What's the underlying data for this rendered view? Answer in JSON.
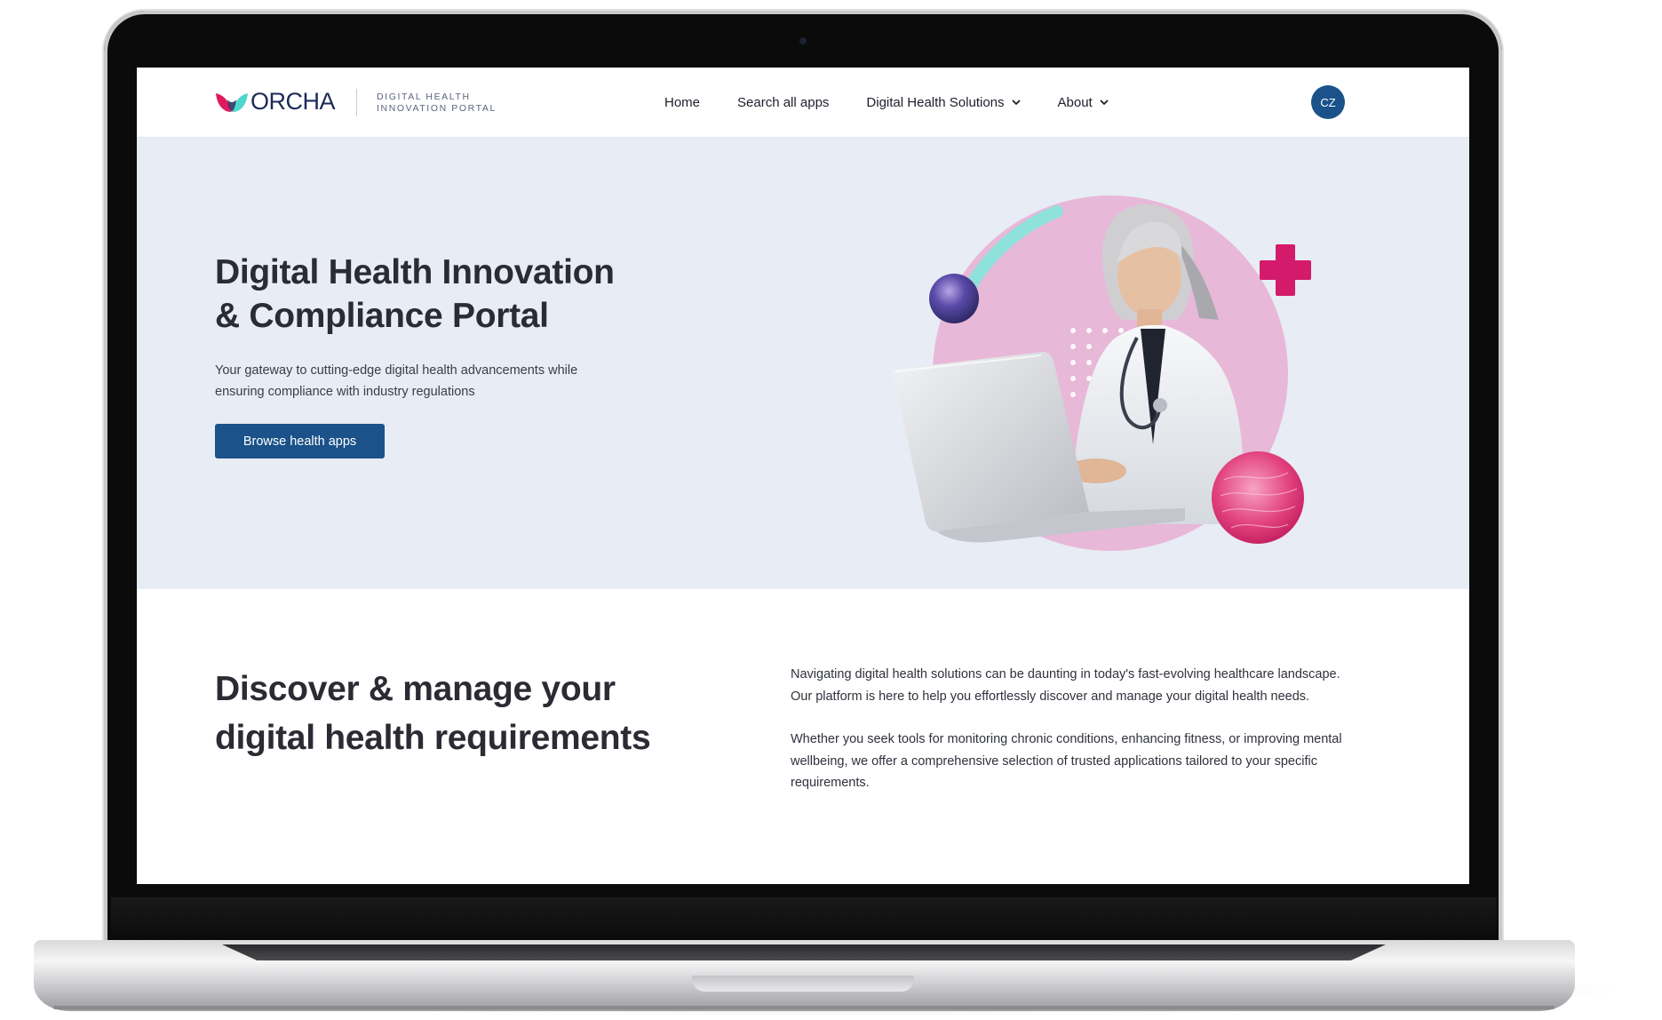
{
  "brand": {
    "name": "ORCHA",
    "subtitle_line1": "DIGITAL HEALTH",
    "subtitle_line2": "INNOVATION PORTAL",
    "colors": {
      "primary": "#1a5289",
      "pink": "#e0195f",
      "teal": "#4fd6cc"
    }
  },
  "nav": {
    "links": [
      {
        "label": "Home",
        "has_dropdown": false
      },
      {
        "label": "Search all apps",
        "has_dropdown": false
      },
      {
        "label": "Digital Health Solutions",
        "has_dropdown": true
      },
      {
        "label": "About",
        "has_dropdown": true
      }
    ],
    "avatar_initials": "CZ"
  },
  "hero": {
    "title_line1": "Digital Health Innovation",
    "title_line2": "& Compliance Portal",
    "subtitle_line1": "Your gateway to cutting-edge digital health advancements while",
    "subtitle_line2": "ensuring compliance with industry regulations",
    "cta_label": "Browse health apps",
    "colors": {
      "background": "#e8ecf5",
      "circle": "#e8b8d8",
      "plus": "#d41a6b"
    }
  },
  "section2": {
    "title_line1": "Discover & manage your",
    "title_line2": "digital health requirements",
    "paragraph1": "Navigating digital health solutions can be daunting in today's fast-evolving healthcare landscape. Our platform is here to help you effortlessly discover and manage your digital health needs.",
    "paragraph2": "Whether you seek tools for monitoring chronic conditions, enhancing fitness, or improving mental wellbeing, we offer a comprehensive selection of trusted applications tailored to your specific requirements."
  }
}
